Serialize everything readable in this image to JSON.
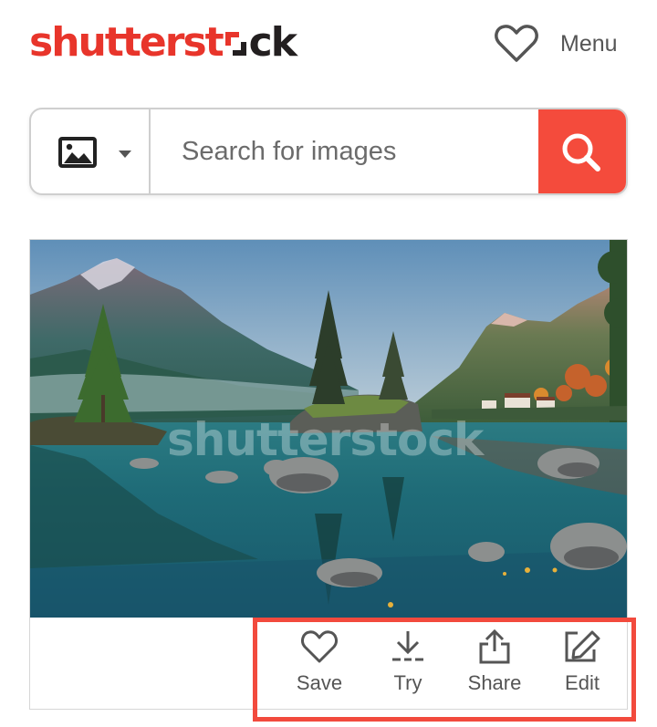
{
  "header": {
    "logo_red": "shutterst",
    "logo_dark": "ck",
    "favorites_icon": "heart-outline-icon",
    "menu_label": "Menu"
  },
  "search": {
    "type_icon": "image-icon",
    "dropdown_icon": "caret-down-icon",
    "placeholder": "Search for images",
    "value": "",
    "button_icon": "search-icon"
  },
  "image": {
    "watermark_text": "shutterstock"
  },
  "actions": [
    {
      "label": "Save",
      "icon": "heart-outline-icon"
    },
    {
      "label": "Try",
      "icon": "download-icon"
    },
    {
      "label": "Share",
      "icon": "share-icon"
    },
    {
      "label": "Edit",
      "icon": "edit-icon"
    }
  ],
  "colors": {
    "brand_red": "#e8352b",
    "search_button": "#f44b3c",
    "highlight_border": "#f24a3d"
  }
}
